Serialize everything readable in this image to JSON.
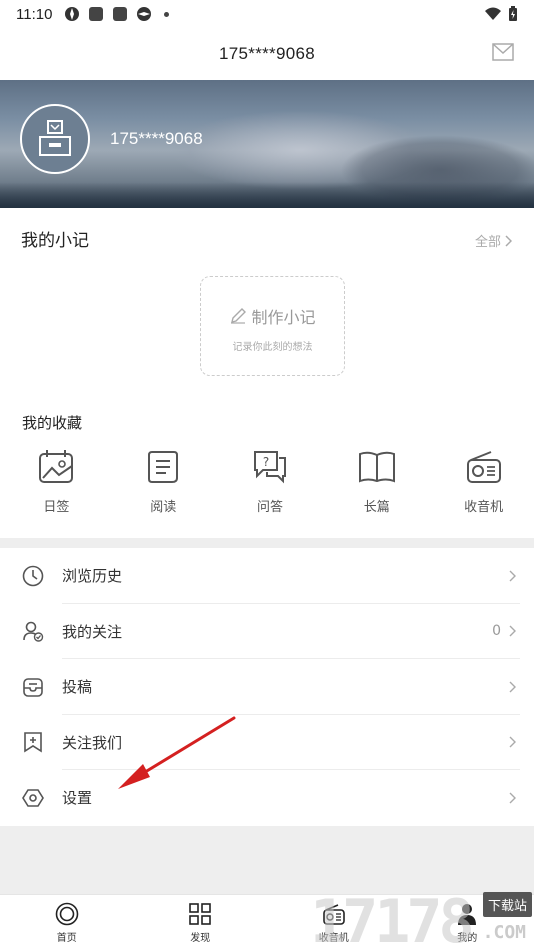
{
  "status_bar": {
    "time": "11:10"
  },
  "header": {
    "title": "175****9068"
  },
  "profile": {
    "username": "175****9068"
  },
  "notes": {
    "title": "我的小记",
    "all_label": "全部",
    "make_title": "制作小记",
    "make_subtitle": "记录你此刻的想法"
  },
  "favorites": {
    "title": "我的收藏",
    "items": [
      {
        "label": "日签",
        "icon": "calendar-icon"
      },
      {
        "label": "阅读",
        "icon": "document-icon"
      },
      {
        "label": "问答",
        "icon": "question-chat-icon"
      },
      {
        "label": "长篇",
        "icon": "book-icon"
      },
      {
        "label": "收音机",
        "icon": "radio-icon"
      }
    ]
  },
  "menu": {
    "items": [
      {
        "label": "浏览历史",
        "icon": "clock-icon",
        "value": ""
      },
      {
        "label": "我的关注",
        "icon": "user-check-icon",
        "value": "0"
      },
      {
        "label": "投稿",
        "icon": "inbox-icon",
        "value": ""
      },
      {
        "label": "关注我们",
        "icon": "bookmark-plus-icon",
        "value": ""
      },
      {
        "label": "设置",
        "icon": "hexagon-settings-icon",
        "value": ""
      }
    ]
  },
  "tabbar": {
    "items": [
      {
        "label": "首页",
        "icon": "home-ring-icon"
      },
      {
        "label": "发现",
        "icon": "grid-icon"
      },
      {
        "label": "收音机",
        "icon": "radio-icon"
      },
      {
        "label": "我的",
        "icon": "person-icon"
      }
    ]
  },
  "watermark": {
    "number": "17178",
    "badge": "下载站",
    "domain": ".COM"
  },
  "colors": {
    "arrow": "#d42020",
    "divider": "#eeeeee"
  }
}
